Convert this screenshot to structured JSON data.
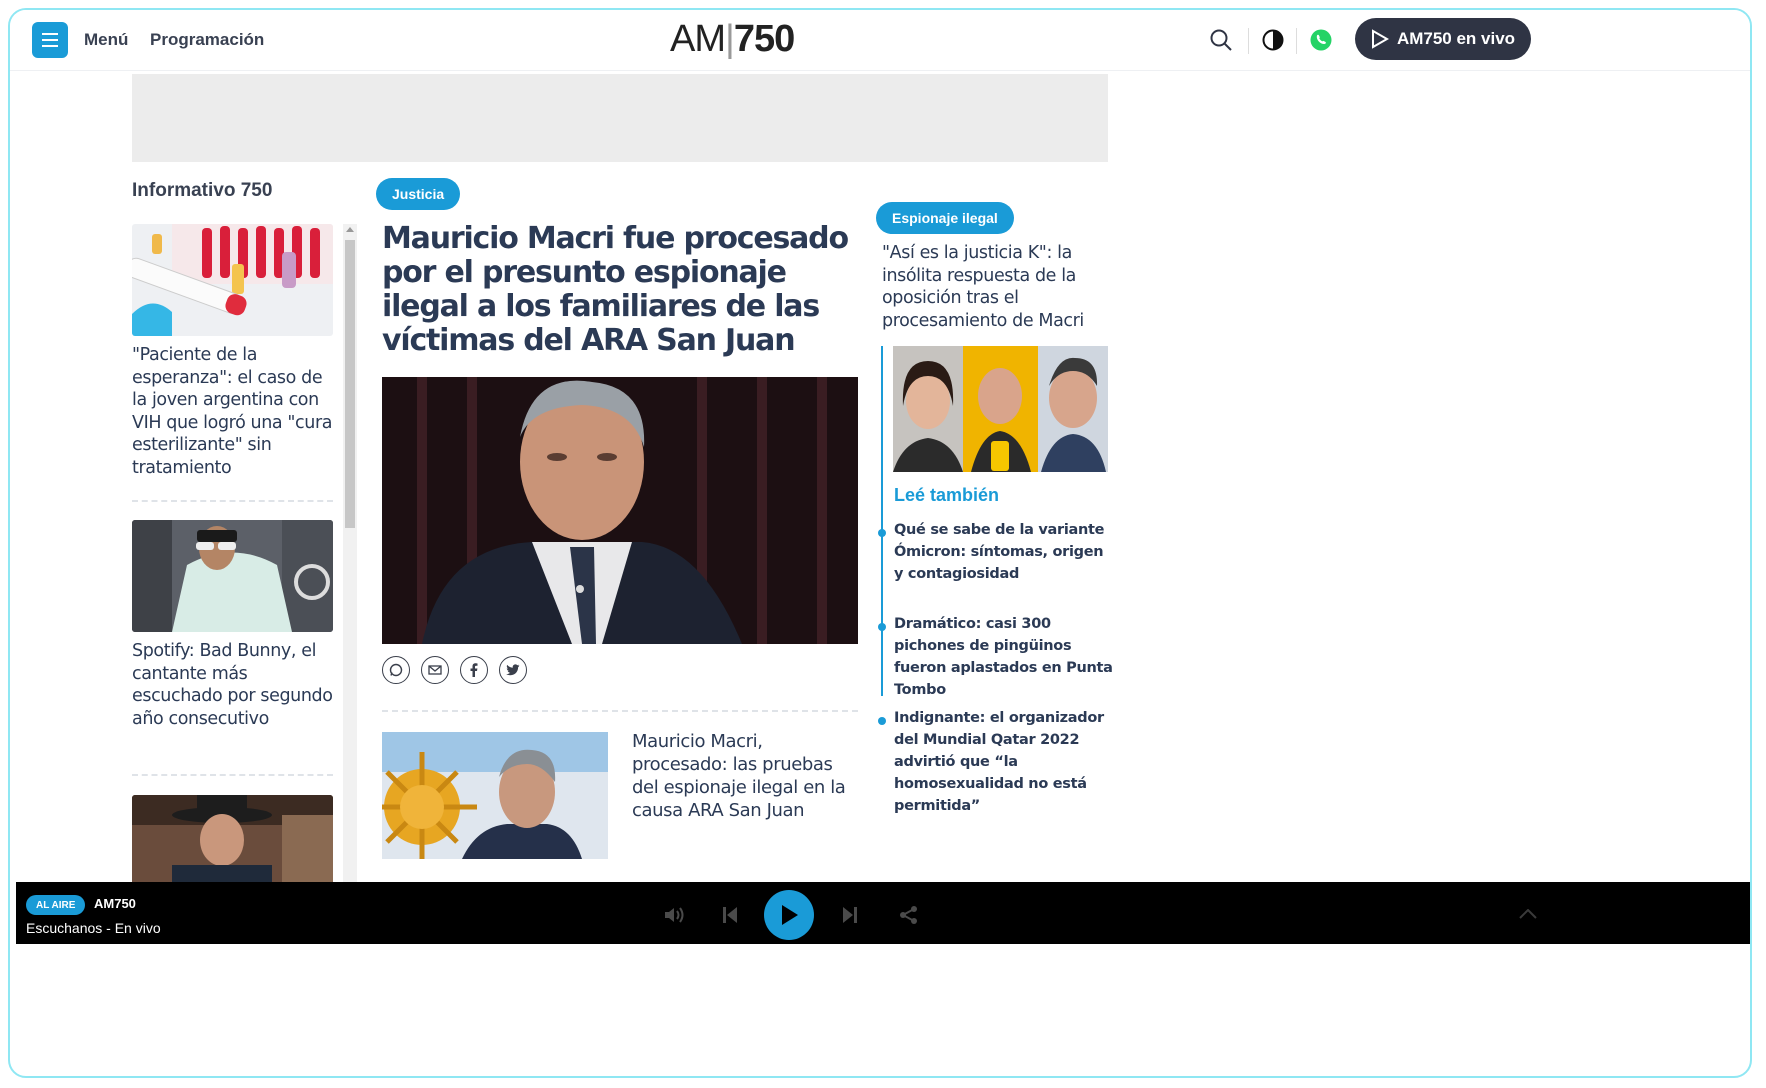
{
  "header": {
    "menu_label": "Menú",
    "programacion_label": "Programación",
    "logo_text_left": "AM",
    "logo_text_right": "750",
    "live_button": "AM750 en vivo"
  },
  "left": {
    "section_title": "Informativo 750",
    "items": [
      {
        "title": "\"Paciente de la esperanza\": el caso de la joven argentina con VIH que logró una \"cura esterilizante\" sin tratamiento"
      },
      {
        "title": "Spotify: Bad Bunny, el cantante más escuchado por segundo año consecutivo"
      },
      {
        "title": ""
      }
    ]
  },
  "main": {
    "tag": "Justicia",
    "title": "Mauricio Macri fue procesado por el presunto espionaje ilegal a los familiares de las víctimas del ARA San Juan",
    "related_title": "Mauricio Macri, procesado: las pruebas del espionaje ilegal en la causa ARA San Juan"
  },
  "right": {
    "tag": "Espionaje ilegal",
    "title": "\"Así es la justicia K\": la insólita respuesta de la oposición tras el procesamiento de Macri",
    "lee_tambien": "Leé también",
    "items": [
      {
        "title": "Qué se sabe de la variante Ómicron: síntomas, origen y contagiosidad"
      },
      {
        "title": "Dramático: casi 300 pichones de pingüinos fueron aplastados en Punta Tombo"
      },
      {
        "title": "Indignante: el organizador del Mundial Qatar 2022 advirtió que “la homosexualidad no está permitida”"
      }
    ]
  },
  "player": {
    "on_air": "AL AIRE",
    "station": "AM750",
    "status": "Escuchanos - En vivo"
  },
  "colors": {
    "accent": "#1a9bd7",
    "dark": "#2f3444",
    "text": "#2b3a55"
  }
}
